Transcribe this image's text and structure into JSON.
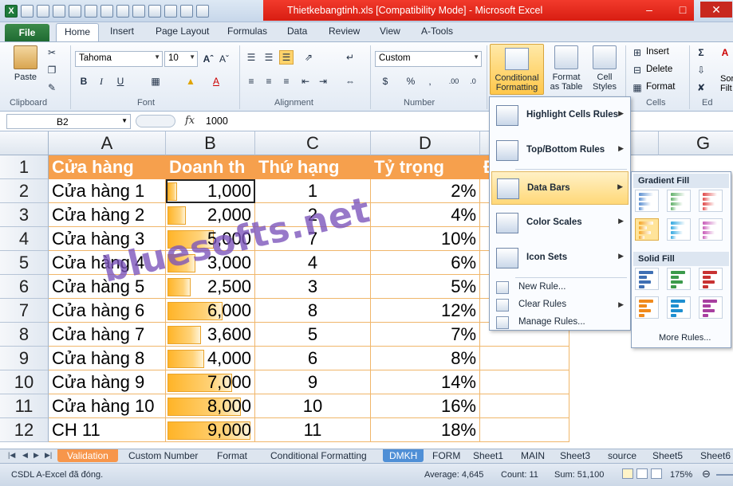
{
  "app": {
    "title": "Thietkebangtinh.xls  [Compatibility Mode]  -  Microsoft Excel",
    "window_controls": [
      "minimize",
      "maximize",
      "close"
    ]
  },
  "ribbon_tabs": [
    "File",
    "Home",
    "Insert",
    "Page Layout",
    "Formulas",
    "Data",
    "Review",
    "View",
    "A-Tools"
  ],
  "active_tab": "Home",
  "ribbon": {
    "clipboard": {
      "paste": "Paste",
      "label": "Clipboard"
    },
    "font": {
      "name": "Tahoma",
      "size": "10",
      "label": "Font"
    },
    "alignment": {
      "label": "Alignment"
    },
    "number": {
      "format": "Custom",
      "label": "Number"
    },
    "styles": {
      "conditional_formatting": "Conditional Formatting",
      "format_as_table": "Format as Table",
      "cell_styles": "Cell Styles"
    },
    "cells": {
      "insert": "Insert",
      "delete": "Delete",
      "format": "Format",
      "label": "Cells"
    },
    "editing": {
      "sort_filter": "Sor Filt",
      "label": "Ed"
    }
  },
  "formula_bar": {
    "name_box": "B2",
    "fx": "fx",
    "value": "1000"
  },
  "columns": [
    "A",
    "B",
    "C",
    "D",
    "E",
    "F",
    "G"
  ],
  "header_row": {
    "row": "1",
    "a": "Cửa hàng",
    "b": "Doanh th",
    "c": "Thứ hạng",
    "d": "Tỷ trọng",
    "e": "Đ"
  },
  "rows": [
    {
      "num": "2",
      "store": "Cửa hàng 1",
      "revenue": "1,000",
      "value": 1000,
      "rank": "1",
      "share": "2%"
    },
    {
      "num": "3",
      "store": "Cửa hàng 2",
      "revenue": "2,000",
      "value": 2000,
      "rank": "2",
      "share": "4%"
    },
    {
      "num": "4",
      "store": "Cửa hàng 3",
      "revenue": "5,000",
      "value": 5000,
      "rank": "7",
      "share": "10%"
    },
    {
      "num": "5",
      "store": "Cửa hàng 4",
      "revenue": "3,000",
      "value": 3000,
      "rank": "4",
      "share": "6%"
    },
    {
      "num": "6",
      "store": "Cửa hàng 5",
      "revenue": "2,500",
      "value": 2500,
      "rank": "3",
      "share": "5%"
    },
    {
      "num": "7",
      "store": "Cửa hàng 6",
      "revenue": "6,000",
      "value": 6000,
      "rank": "8",
      "share": "12%"
    },
    {
      "num": "8",
      "store": "Cửa hàng 7",
      "revenue": "3,600",
      "value": 3600,
      "rank": "5",
      "share": "7%"
    },
    {
      "num": "9",
      "store": "Cửa hàng 8",
      "revenue": "4,000",
      "value": 4000,
      "rank": "6",
      "share": "8%"
    },
    {
      "num": "10",
      "store": "Cửa hàng 9",
      "revenue": "7,000",
      "value": 7000,
      "rank": "9",
      "share": "14%"
    },
    {
      "num": "11",
      "store": "Cửa hàng 10",
      "revenue": "8,000",
      "value": 8000,
      "rank": "10",
      "share": "16%"
    },
    {
      "num": "12",
      "store": "CH 11",
      "revenue": "9,000",
      "value": 9000,
      "rank": "11",
      "share": "18%"
    }
  ],
  "watermark": "bluesofts.net",
  "cf_menu": {
    "items": [
      "Highlight Cells Rules",
      "Top/Bottom Rules",
      "Data Bars",
      "Color Scales",
      "Icon Sets"
    ],
    "actions": [
      "New Rule...",
      "Clear Rules",
      "Manage Rules..."
    ]
  },
  "data_bars_menu": {
    "gradient": "Gradient Fill",
    "solid": "Solid Fill",
    "more": "More Rules...",
    "gradient_colors": [
      "#5b8fd1",
      "#62b06a",
      "#e04848",
      "#f5a623",
      "#33a8e0",
      "#c85bb8"
    ],
    "solid_colors": [
      "#3f6fb3",
      "#3c9a4b",
      "#c83232",
      "#f08a1c",
      "#1e8fd0",
      "#a83fa0"
    ]
  },
  "sheet_tabs": [
    "Validation",
    "Custom Number",
    "Format",
    "Conditional Formatting",
    "DMKH",
    "FORM",
    "Sheet1",
    "MAIN",
    "Sheet3",
    "source",
    "Sheet5",
    "Sheet6"
  ],
  "status": {
    "message": "CSDL A-Excel đã đóng.",
    "average": "Average:  4,645",
    "count": "Count: 11",
    "sum": "Sum:  51,100",
    "zoom": "175%"
  }
}
